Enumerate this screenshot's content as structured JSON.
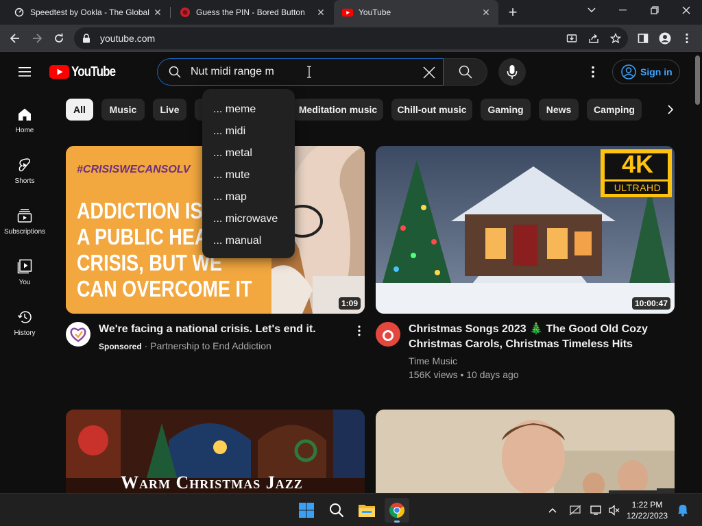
{
  "browser": {
    "tabs": [
      {
        "title": "Speedtest by Ookla - The Global",
        "active": false
      },
      {
        "title": "Guess the PIN - Bored Button",
        "active": false
      },
      {
        "title": "YouTube",
        "active": true
      }
    ],
    "url": "youtube.com"
  },
  "youtube": {
    "logo_text": "YouTube",
    "search": {
      "value": "Nut midi range m",
      "suggestions": [
        "... meme",
        "... midi",
        "... metal",
        "... mute",
        "... map",
        "... microwave",
        "... manual"
      ]
    },
    "sign_in_label": "Sign in",
    "sidebar": [
      {
        "label": "Home",
        "icon": "home-icon"
      },
      {
        "label": "Shorts",
        "icon": "shorts-icon"
      },
      {
        "label": "Subscriptions",
        "icon": "subscriptions-icon"
      },
      {
        "label": "You",
        "icon": "you-icon"
      },
      {
        "label": "History",
        "icon": "history-icon"
      }
    ],
    "chips": [
      "All",
      "Music",
      "Live",
      "Meditation music",
      "Chill-out music",
      "Gaming",
      "News",
      "Camping"
    ],
    "videos": [
      {
        "thumb_text": [
          "ADDICTION IS",
          "A PUBLIC HEAL",
          "CRISIS, BUT WE",
          "CAN OVERCOME IT"
        ],
        "thumb_hashtag": "#CRISISWECANSOLV",
        "duration": "1:09",
        "title": "We're facing a national crisis. Let's end it.",
        "sponsored": "Sponsored",
        "channel": "Partnership to End Addiction"
      },
      {
        "badge_top": "4K",
        "badge_bottom": "ULTRAHD",
        "duration": "10:00:47",
        "title_line1": "Christmas Songs 2023 🎄 The Good Old Cozy",
        "title_line2": "Christmas Carols, Christmas Timeless Hits",
        "channel": "Time Music",
        "meta": "156K views • 10 days ago"
      },
      {
        "thumb_text": "Warm Christmas Jazz"
      },
      {}
    ]
  },
  "taskbar": {
    "time": "1:22 PM",
    "date": "12/22/2023"
  },
  "colors": {
    "yt_red": "#ff0000",
    "link_blue": "#3ea6ff",
    "bg": "#0f0f0f"
  }
}
